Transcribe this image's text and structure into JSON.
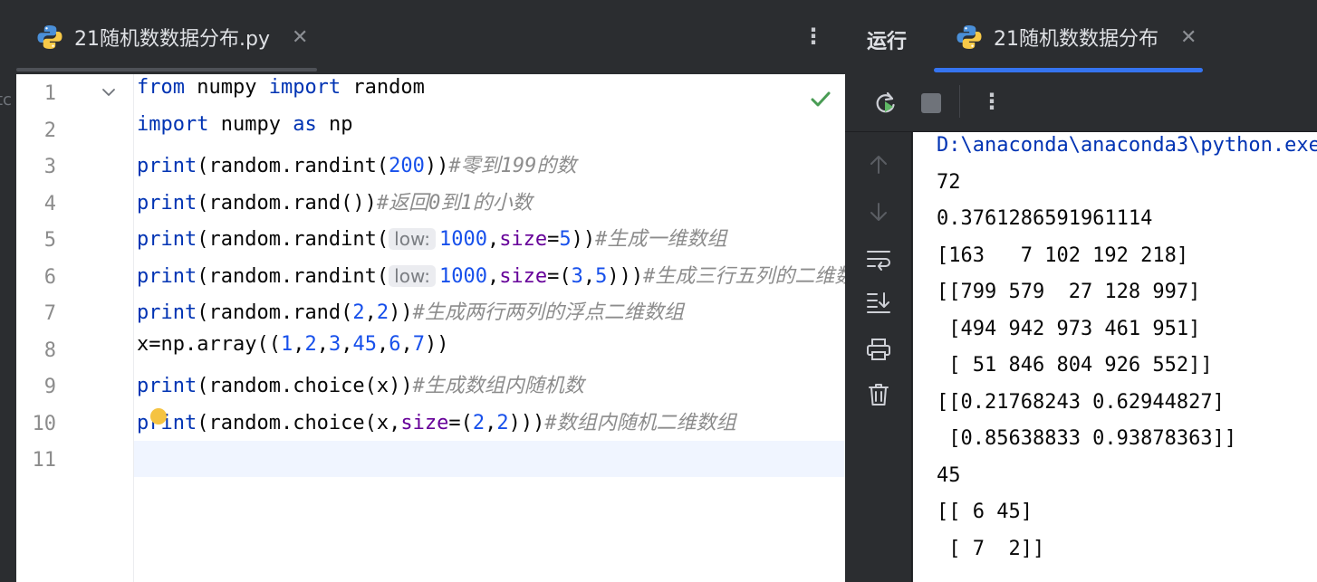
{
  "editor": {
    "tab_title": "21随机数数据分布.py",
    "tab_close": "✕",
    "more": "⋮",
    "left_ghost": "tc",
    "line_numbers": [
      "1",
      "2",
      "3",
      "4",
      "5",
      "6",
      "7",
      "8",
      "9",
      "10",
      "11"
    ],
    "lines": [
      [
        {
          "t": "from",
          "c": "kw"
        },
        {
          "t": " numpy ",
          "c": "fn"
        },
        {
          "t": "import",
          "c": "kw"
        },
        {
          "t": " random",
          "c": "fn"
        }
      ],
      [
        {
          "t": "import",
          "c": "kw"
        },
        {
          "t": " numpy ",
          "c": "fn"
        },
        {
          "t": "as",
          "c": "kw"
        },
        {
          "t": " np",
          "c": "fn"
        }
      ],
      [
        {
          "t": "print",
          "c": "kw"
        },
        {
          "t": "(random.randint(",
          "c": "fn"
        },
        {
          "t": "200",
          "c": "num"
        },
        {
          "t": "))",
          "c": "fn"
        },
        {
          "t": "#零到199的数",
          "c": "cmt"
        }
      ],
      [
        {
          "t": "print",
          "c": "kw"
        },
        {
          "t": "(random.rand())",
          "c": "fn"
        },
        {
          "t": "#返回0到1的小数",
          "c": "cmt"
        }
      ],
      [
        {
          "t": "print",
          "c": "kw"
        },
        {
          "t": "(random.randint(",
          "c": "fn"
        },
        {
          "t": "low:",
          "c": "hint"
        },
        {
          "t": "1000",
          "c": "num"
        },
        {
          "t": ",",
          "c": "fn"
        },
        {
          "t": "size",
          "c": "named"
        },
        {
          "t": "=",
          "c": "fn"
        },
        {
          "t": "5",
          "c": "num"
        },
        {
          "t": "))",
          "c": "fn"
        },
        {
          "t": "#生成一维数组",
          "c": "cmt"
        }
      ],
      [
        {
          "t": "print",
          "c": "kw"
        },
        {
          "t": "(random.randint(",
          "c": "fn"
        },
        {
          "t": "low:",
          "c": "hint"
        },
        {
          "t": "1000",
          "c": "num"
        },
        {
          "t": ",",
          "c": "fn"
        },
        {
          "t": "size",
          "c": "named"
        },
        {
          "t": "=(",
          "c": "fn"
        },
        {
          "t": "3",
          "c": "num"
        },
        {
          "t": ",",
          "c": "fn"
        },
        {
          "t": "5",
          "c": "num"
        },
        {
          "t": ")))",
          "c": "fn"
        },
        {
          "t": "#生成三行五列的二维数组",
          "c": "cmt"
        }
      ],
      [
        {
          "t": "print",
          "c": "kw"
        },
        {
          "t": "(random.rand(",
          "c": "fn"
        },
        {
          "t": "2",
          "c": "num"
        },
        {
          "t": ",",
          "c": "fn"
        },
        {
          "t": "2",
          "c": "num"
        },
        {
          "t": "))",
          "c": "fn"
        },
        {
          "t": "#生成两行两列的浮点二维数组",
          "c": "cmt"
        }
      ],
      [
        {
          "t": "x=np.array((",
          "c": "fn"
        },
        {
          "t": "1",
          "c": "num"
        },
        {
          "t": ",",
          "c": "fn"
        },
        {
          "t": "2",
          "c": "num"
        },
        {
          "t": ",",
          "c": "fn"
        },
        {
          "t": "3",
          "c": "num"
        },
        {
          "t": ",",
          "c": "fn"
        },
        {
          "t": "45",
          "c": "num"
        },
        {
          "t": ",",
          "c": "fn"
        },
        {
          "t": "6",
          "c": "num"
        },
        {
          "t": ",",
          "c": "fn"
        },
        {
          "t": "7",
          "c": "num"
        },
        {
          "t": "))",
          "c": "fn"
        }
      ],
      [
        {
          "t": "print",
          "c": "kw"
        },
        {
          "t": "(random.choice(x))",
          "c": "fn"
        },
        {
          "t": "#生成数组内随机数",
          "c": "cmt"
        }
      ],
      [
        {
          "t": "print",
          "c": "kw"
        },
        {
          "t": "(random.choice(x,",
          "c": "fn"
        },
        {
          "t": "size",
          "c": "named"
        },
        {
          "t": "=(",
          "c": "fn"
        },
        {
          "t": "2",
          "c": "num"
        },
        {
          "t": ",",
          "c": "fn"
        },
        {
          "t": "2",
          "c": "num"
        },
        {
          "t": ")))",
          "c": "fn"
        },
        {
          "t": "#数组内随机二维数组",
          "c": "cmt"
        }
      ],
      []
    ],
    "current_line": 11
  },
  "run": {
    "title": "运行",
    "tab_title": "21随机数数据分布",
    "tab_close": "✕",
    "more": "⋮",
    "console_lines": [
      "D:\\anaconda\\anaconda3\\python.exe",
      "72",
      "0.3761286591961114",
      "[163   7 102 192 218]",
      "[[799 579  27 128 997]",
      " [494 942 973 461 951]",
      " [ 51 846 804 926 552]]",
      "[[0.21768243 0.62944827]",
      " [0.85638833 0.93878363]]",
      "45",
      "[[ 6 45]",
      " [ 7  2]]"
    ]
  },
  "colors": {
    "keyword": "#0033b3",
    "number": "#1750eb",
    "named_arg": "#660099",
    "comment": "#8c8c8c",
    "accent": "#3574f0",
    "success": "#499c54"
  }
}
